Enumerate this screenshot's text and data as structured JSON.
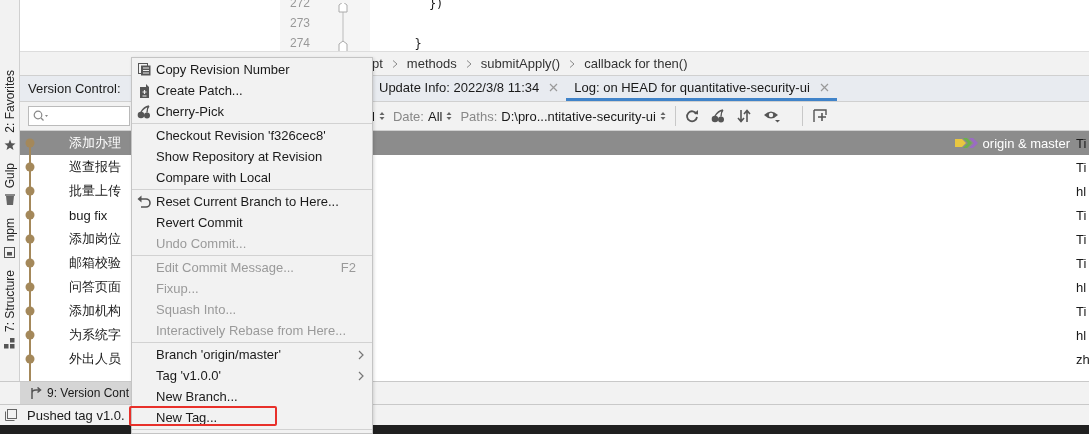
{
  "left_toolbar": [
    {
      "label": "2: Favorites",
      "kind": "star"
    },
    {
      "label": "Gulp",
      "kind": "cup"
    },
    {
      "label": "npm",
      "kind": "square"
    },
    {
      "label": "7: Structure",
      "kind": "blocks"
    }
  ],
  "editor": {
    "lines": [
      {
        "number": "272",
        "code": "    })"
      },
      {
        "number": "273"
      },
      {
        "number": "274",
        "code": "  }"
      }
    ]
  },
  "breadcrumbs": [
    "pt",
    "methods",
    "submitApply()",
    "callback for then()"
  ],
  "tool_window": {
    "title": "Version Control:",
    "tabs": [
      {
        "label": "Update Info: 2022/3/8 11:34",
        "selected": false
      },
      {
        "label": "Log: on HEAD for quantitative-security-ui",
        "selected": true
      }
    ]
  },
  "filters": [
    {
      "value": "l"
    },
    {
      "label": "Date:",
      "value": "All"
    },
    {
      "label": "Paths:",
      "value": "D:\\pro...ntitative-security-ui"
    }
  ],
  "commits": [
    {
      "message": "添加办理",
      "refs": "origin & master",
      "author": "Ti",
      "selected": true
    },
    {
      "message": "巡查报告",
      "author": "Ti",
      "selected": false
    },
    {
      "message": "批量上传",
      "author": "hl",
      "selected": false
    },
    {
      "message": "bug fix",
      "author": "Ti",
      "selected": false
    },
    {
      "message": "添加岗位",
      "author": "Ti",
      "selected": false
    },
    {
      "message": "邮箱校验",
      "author": "Ti",
      "selected": false
    },
    {
      "message": "问答页面",
      "author": "hl",
      "selected": false
    },
    {
      "message": "添加机构",
      "author": "Ti",
      "selected": false
    },
    {
      "message": "为系统字",
      "author": "hl",
      "selected": false
    },
    {
      "message": "外出人员",
      "author": "zh",
      "selected": false
    }
  ],
  "bottom_tab": "9: Version Cont",
  "status": "Pushed tag v1.0.",
  "context_menu": {
    "groups": [
      [
        {
          "label": "Copy Revision Number",
          "kind": "copy",
          "disabled": false,
          "marked": false
        },
        {
          "label": "Create Patch...",
          "kind": "patch",
          "disabled": false,
          "marked": false
        },
        {
          "label": "Cherry-Pick",
          "kind": "cherry",
          "disabled": false,
          "marked": false
        }
      ],
      [
        {
          "label": "Checkout Revision 'f326cec8'",
          "kind": "plain",
          "disabled": false,
          "marked": false
        },
        {
          "label": "Show Repository at Revision",
          "kind": "plain",
          "disabled": false,
          "marked": false
        },
        {
          "label": "Compare with Local",
          "kind": "plain",
          "disabled": false,
          "marked": false
        }
      ],
      [
        {
          "label": "Reset Current Branch to Here...",
          "kind": "reset",
          "disabled": false,
          "marked": false
        },
        {
          "label": "Revert Commit",
          "kind": "plain",
          "disabled": false,
          "marked": false
        },
        {
          "label": "Undo Commit...",
          "kind": "plain",
          "disabled": true,
          "marked": false
        }
      ],
      [
        {
          "label": "Edit Commit Message...",
          "shortcut": "F2",
          "kind": "plain",
          "disabled": true,
          "marked": false
        },
        {
          "label": "Fixup...",
          "kind": "plain",
          "disabled": true,
          "marked": false
        },
        {
          "label": "Squash Into...",
          "kind": "plain",
          "disabled": true,
          "marked": false
        },
        {
          "label": "Interactively Rebase from Here...",
          "kind": "plain",
          "disabled": true,
          "marked": false
        }
      ],
      [
        {
          "label": "Branch 'origin/master'",
          "kind": "submenu",
          "disabled": false,
          "marked": false
        },
        {
          "label": "Tag 'v1.0.0'",
          "kind": "submenu",
          "disabled": false,
          "marked": false
        },
        {
          "label": "New Branch...",
          "kind": "plain",
          "disabled": false,
          "marked": false
        },
        {
          "label": "New Tag...",
          "kind": "plain",
          "disabled": false,
          "marked": true
        }
      ]
    ]
  }
}
